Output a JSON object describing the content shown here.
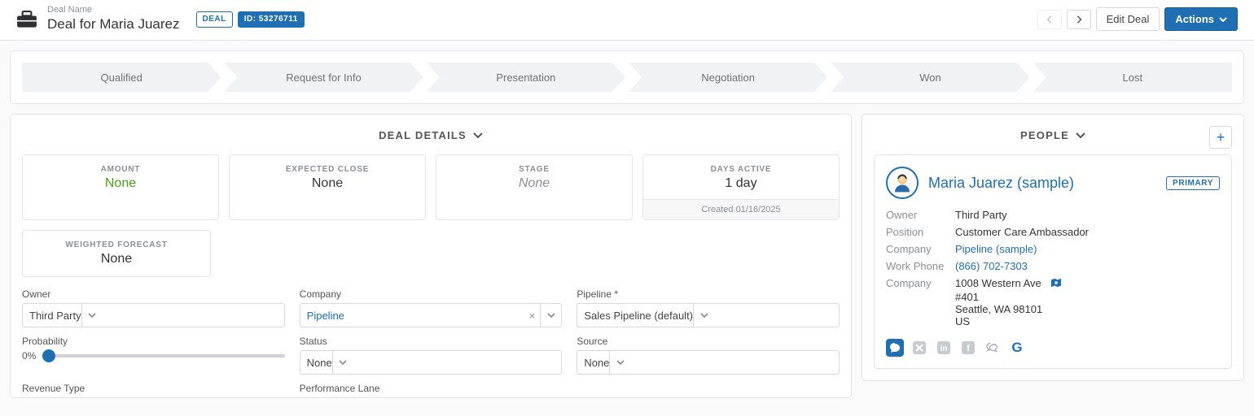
{
  "header": {
    "label": "Deal Name",
    "name": "Deal for Maria Juarez",
    "deal_badge": "DEAL",
    "id_badge": "ID: 53276711",
    "edit": "Edit Deal",
    "actions": "Actions"
  },
  "stages": [
    "Qualified",
    "Request for Info",
    "Presentation",
    "Negotiation",
    "Won",
    "Lost"
  ],
  "details": {
    "title": "DEAL DETAILS",
    "tiles": {
      "amount": {
        "title": "AMOUNT",
        "value": "None"
      },
      "expected": {
        "title": "EXPECTED CLOSE",
        "value": "None"
      },
      "stage": {
        "title": "STAGE",
        "value": "None"
      },
      "days": {
        "title": "DAYS ACTIVE",
        "value": "1 day",
        "created": "Created 01/16/2025"
      },
      "weighted": {
        "title": "WEIGHTED FORECAST",
        "value": "None"
      }
    },
    "fields": {
      "owner": {
        "label": "Owner",
        "value": "Third Party"
      },
      "company": {
        "label": "Company",
        "value": "Pipeline"
      },
      "pipeline": {
        "label": "Pipeline *",
        "value": "Sales Pipeline (default)"
      },
      "probability": {
        "label": "Probability",
        "value": "0%"
      },
      "status": {
        "label": "Status",
        "value": "None"
      },
      "source": {
        "label": "Source",
        "value": "None"
      },
      "revenue_type": {
        "label": "Revenue Type"
      },
      "performance_lane": {
        "label": "Performance Lane"
      }
    }
  },
  "people": {
    "title": "PEOPLE",
    "person": {
      "name": "Maria Juarez (sample)",
      "primary": "PRIMARY",
      "fields": {
        "owner": {
          "k": "Owner",
          "v": "Third Party"
        },
        "position": {
          "k": "Position",
          "v": "Customer Care Ambassador"
        },
        "company": {
          "k": "Company",
          "v": "Pipeline (sample)"
        },
        "phone": {
          "k": "Work Phone",
          "v": "(866) 702-7303"
        },
        "address_label": "Company",
        "address_line1": "1008 Western Ave",
        "address_line2": "#401",
        "address_line3": "Seattle, WA 98101",
        "address_line4": "US"
      }
    }
  }
}
